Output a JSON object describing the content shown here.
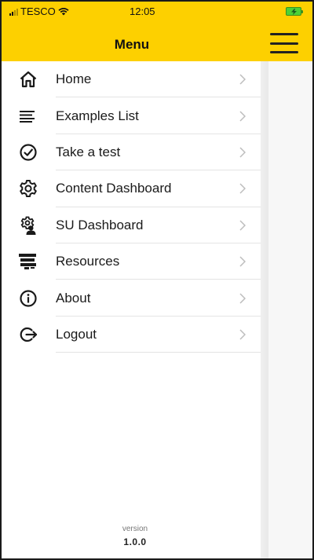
{
  "status_bar": {
    "carrier": "TESCO",
    "time": "12:05"
  },
  "header": {
    "title": "Menu",
    "menu_icon": "hamburger-icon"
  },
  "menu": {
    "items": [
      {
        "label": "Home",
        "icon": "home-icon"
      },
      {
        "label": "Examples List",
        "icon": "list-icon"
      },
      {
        "label": "Take a test",
        "icon": "check-circle-icon"
      },
      {
        "label": "Content Dashboard",
        "icon": "gear-icon"
      },
      {
        "label": "SU Dashboard",
        "icon": "user-gear-icon"
      },
      {
        "label": "Resources",
        "icon": "resources-icon"
      },
      {
        "label": "About",
        "icon": "info-icon"
      },
      {
        "label": "Logout",
        "icon": "logout-icon"
      }
    ]
  },
  "footer": {
    "version_label": "version",
    "version_number": "1.0.0"
  },
  "colors": {
    "brand_yellow": "#fdd000",
    "text": "#1a1a1a",
    "divider": "#e4e4e4",
    "chevron": "#bdbdbd"
  }
}
